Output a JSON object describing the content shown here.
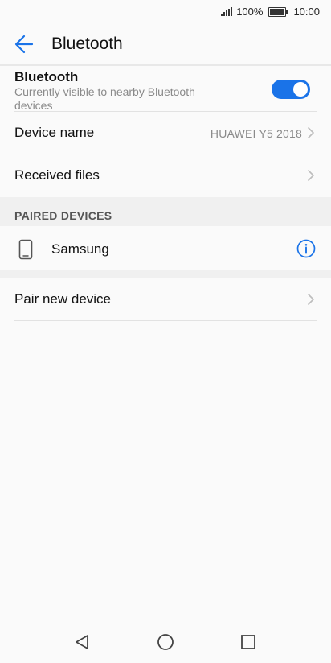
{
  "status_bar": {
    "battery_percent": "100%",
    "battery_level": 0.95,
    "time": "10:00",
    "icons": [
      "signal-icon",
      "battery-icon"
    ]
  },
  "app_bar": {
    "title": "Bluetooth",
    "back_icon": "back-arrow-icon"
  },
  "bluetooth_toggle": {
    "title": "Bluetooth",
    "subtitle": "Currently visible to nearby Bluetooth devices",
    "enabled": true
  },
  "settings": {
    "device_name": {
      "label": "Device name",
      "value": "HUAWEI Y5 2018"
    },
    "received_files": {
      "label": "Received files"
    }
  },
  "paired_section": {
    "header": "PAIRED DEVICES",
    "devices": [
      {
        "name": "Samsung",
        "icon": "phone-icon",
        "action_icon": "info-icon"
      }
    ]
  },
  "pair_new": {
    "label": "Pair new device"
  },
  "nav_bar": {
    "icons": [
      "back-triangle-icon",
      "home-circle-icon",
      "recents-square-icon"
    ]
  },
  "colors": {
    "accent": "#1a73e8",
    "background": "#fafafa",
    "section_band": "#f0f0f0",
    "secondary_text": "#8a8a8a"
  }
}
